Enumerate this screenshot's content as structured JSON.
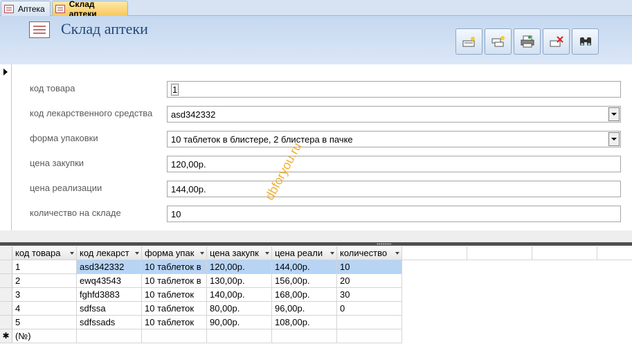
{
  "tabs": [
    {
      "label": "Аптека",
      "active": false
    },
    {
      "label": "Склад аптеки",
      "active": true
    }
  ],
  "form": {
    "title": "Склад аптеки",
    "toolbar": [
      {
        "name": "new-record-icon"
      },
      {
        "name": "duplicate-record-icon"
      },
      {
        "name": "print-icon"
      },
      {
        "name": "delete-record-icon"
      },
      {
        "name": "find-icon"
      }
    ],
    "fields": {
      "product_code": {
        "label": "код товара",
        "value": "1"
      },
      "drug_code": {
        "label": "код лекарственного средства",
        "value": "asd342332"
      },
      "packaging": {
        "label": "форма упаковки",
        "value": "10 таблеток в блистере, 2 блистера в пачке"
      },
      "purchase_price": {
        "label": "цена закупки",
        "value": "120,00р."
      },
      "sale_price": {
        "label": "цена реализации",
        "value": "144,00р."
      },
      "stock_qty": {
        "label": "количество на складе",
        "value": "10"
      }
    }
  },
  "watermark": "dbforyou.ru",
  "datasheet": {
    "columns": [
      "код товара",
      "код лекарст",
      "форма упак",
      "цена закупк",
      "цена реали",
      "количество"
    ],
    "rows": [
      [
        "1",
        "asd342332",
        "10 таблеток в",
        "120,00р.",
        "144,00р.",
        "10"
      ],
      [
        "2",
        "ewq43543",
        "10 таблеток в",
        "130,00р.",
        "156,00р.",
        "20"
      ],
      [
        "3",
        "fghfd3883",
        "10 таблеток",
        "140,00р.",
        "168,00р.",
        "30"
      ],
      [
        "4",
        "sdfssa",
        "10 таблеток",
        "80,00р.",
        "96,00р.",
        "0"
      ],
      [
        "5",
        "sdfssads",
        "10 таблеток",
        "90,00р.",
        "108,00р.",
        ""
      ]
    ],
    "new_row_marker": "(№)",
    "new_row_symbol": "✱"
  }
}
